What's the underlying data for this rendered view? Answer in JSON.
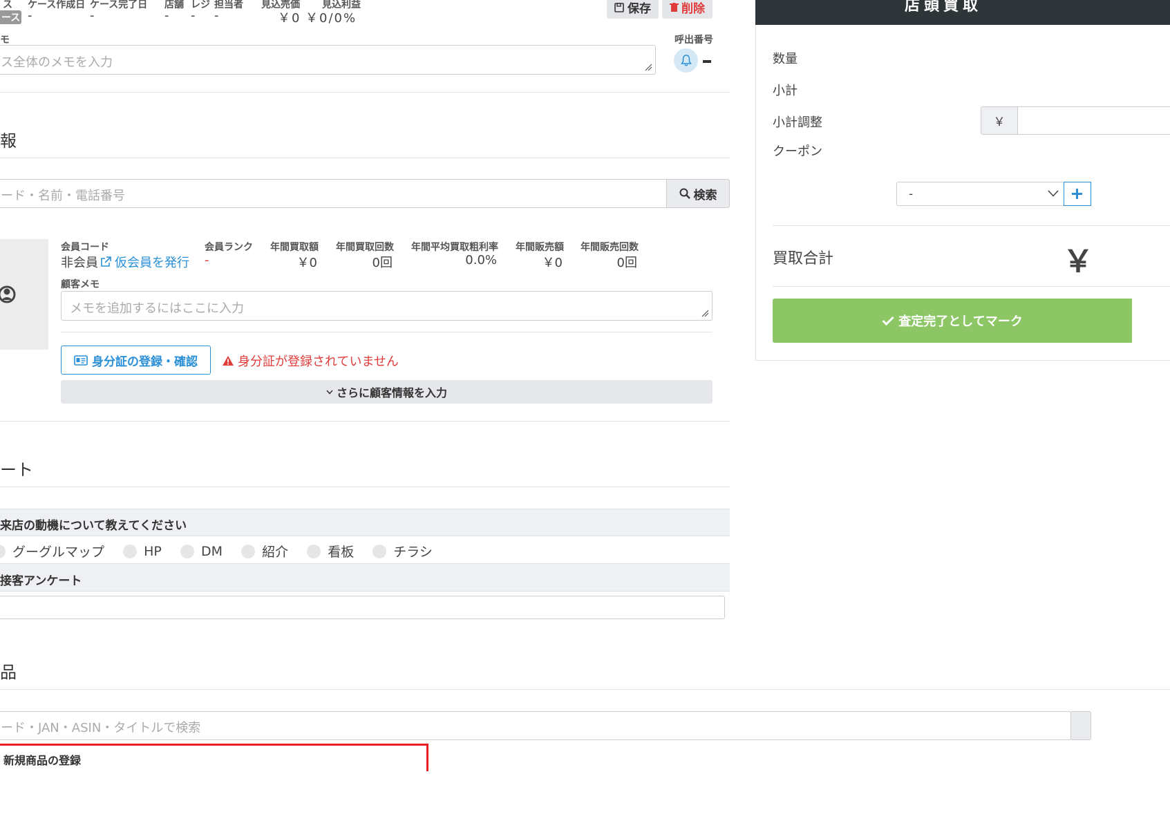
{
  "header": {
    "cols": [
      {
        "label": "ス",
        "value": "ース"
      },
      {
        "label": "ケース作成日",
        "value": "-"
      },
      {
        "label": "ケース完了日",
        "value": "-"
      },
      {
        "label": "店舗",
        "value": "-"
      },
      {
        "label": "レジ",
        "value": "-"
      },
      {
        "label": "担当者",
        "value": "-"
      },
      {
        "label": "見込売価",
        "value": "￥0"
      },
      {
        "label": "見込利益",
        "value": "￥0/0%"
      }
    ],
    "status_dash": "-",
    "save_label": "保存",
    "delete_label": "削除"
  },
  "memo": {
    "label": "モ",
    "placeholder": "ス全体のメモを入力",
    "call_label": "呼出番号",
    "call_value": "-"
  },
  "customer": {
    "section_title": "報",
    "search_placeholder": "ード・名前・電話番号",
    "search_button": "検索",
    "stats": [
      {
        "label": "会員コード",
        "value": "非会員"
      },
      {
        "label": "会員ランク",
        "value": "-"
      },
      {
        "label": "年間買取額",
        "value": "￥0"
      },
      {
        "label": "年間買取回数",
        "value": "0回"
      },
      {
        "label": "年間平均買取粗利率",
        "value": "0.0%"
      },
      {
        "label": "年間販売額",
        "value": "￥0"
      },
      {
        "label": "年間販売回数",
        "value": "0回"
      }
    ],
    "issue_link": "仮会員を発行",
    "memo_label": "顧客メモ",
    "memo_placeholder": "メモを追加するにはここに入力",
    "id_button": "身分証の登録・確認",
    "id_warning": "身分証が登録されていません",
    "more_button": "さらに顧客情報を入力"
  },
  "survey": {
    "section_title": "ート",
    "q1": "来店の動機について教えてください",
    "options": [
      "グーグルマップ",
      "HP",
      "DM",
      "紹介",
      "看板",
      "チラシ"
    ],
    "q2": "接客アンケート"
  },
  "products": {
    "section_title": "品",
    "search_placeholder": "ード・JAN・ASIN・タイトルで検索",
    "new_product": "新規商品の登録"
  },
  "sidebar": {
    "title": "店頭買取",
    "quantity": "数量",
    "subtotal": "小計",
    "adjust": "小計調整",
    "yen": "￥",
    "coupon": "クーポン",
    "coupon_value": "-",
    "total_label": "買取合計",
    "total_value": "￥",
    "complete_button": "査定完了としてマーク"
  },
  "colors": {
    "accent": "#2a8fd6",
    "danger": "#e03c3c",
    "success": "#8cc665",
    "dark_header": "#2d3538"
  }
}
